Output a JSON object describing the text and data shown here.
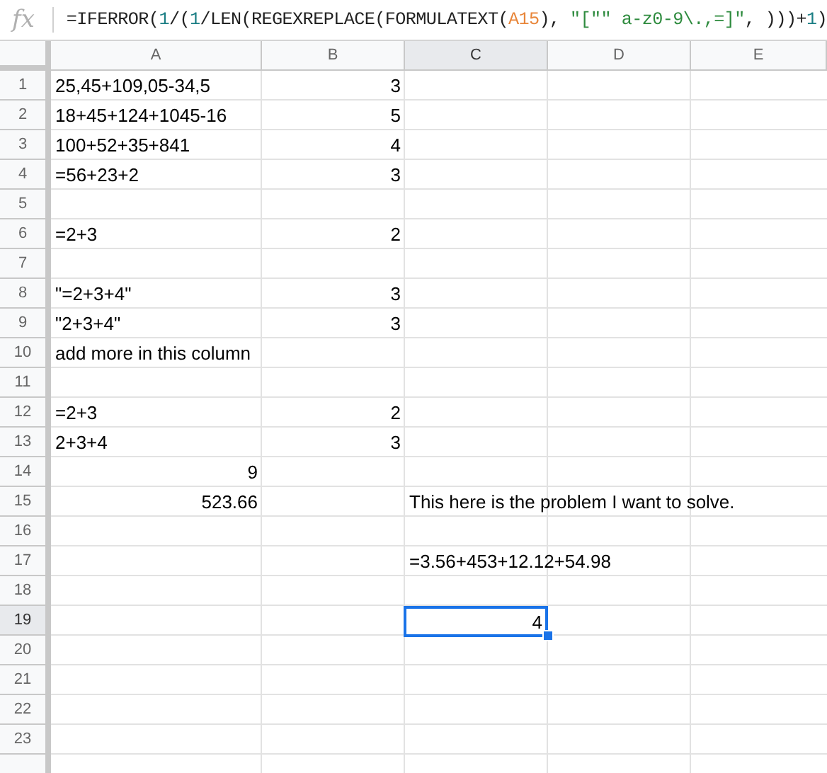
{
  "formula_bar": {
    "icon": "fx",
    "formula": [
      {
        "kind": "func",
        "text": "=IFERROR("
      },
      {
        "kind": "number",
        "text": "1"
      },
      {
        "kind": "func",
        "text": "/("
      },
      {
        "kind": "number",
        "text": "1"
      },
      {
        "kind": "func",
        "text": "/LEN(REGEXREPLACE(FORMULATEXT("
      },
      {
        "kind": "ref",
        "text": "A15"
      },
      {
        "kind": "func",
        "text": "), "
      },
      {
        "kind": "string",
        "text": "\"[\"\" a-z0-9\\.,=]\""
      },
      {
        "kind": "func",
        "text": ", )))+"
      },
      {
        "kind": "number",
        "text": "1"
      },
      {
        "kind": "func",
        "text": ")"
      }
    ]
  },
  "columns": [
    {
      "label": "A",
      "selected": false
    },
    {
      "label": "B",
      "selected": false
    },
    {
      "label": "C",
      "selected": true
    },
    {
      "label": "D",
      "selected": false
    },
    {
      "label": "E",
      "selected": false
    }
  ],
  "rows": [
    {
      "label": "1",
      "selected": false,
      "A": {
        "text": "25,45+109,05-34,5",
        "kind": "text",
        "selected": false
      },
      "B": {
        "text": "3",
        "kind": "number",
        "selected": false
      }
    },
    {
      "label": "2",
      "selected": false,
      "A": {
        "text": "18+45+124+1045-16",
        "kind": "text",
        "selected": false
      },
      "B": {
        "text": "5",
        "kind": "number",
        "selected": false
      }
    },
    {
      "label": "3",
      "selected": false,
      "A": {
        "text": "100+52+35+841",
        "kind": "text",
        "selected": false
      },
      "B": {
        "text": "4",
        "kind": "number",
        "selected": false
      }
    },
    {
      "label": "4",
      "selected": false,
      "A": {
        "text": "=56+23+2",
        "kind": "text",
        "selected": false
      },
      "B": {
        "text": "3",
        "kind": "number",
        "selected": false
      }
    },
    {
      "label": "5",
      "selected": false
    },
    {
      "label": "6",
      "selected": false,
      "A": {
        "text": "=2+3",
        "kind": "text",
        "selected": false
      },
      "B": {
        "text": "2",
        "kind": "number",
        "selected": false
      }
    },
    {
      "label": "7",
      "selected": false
    },
    {
      "label": "8",
      "selected": false,
      "A": {
        "text": "\"=2+3+4\"",
        "kind": "text",
        "selected": false
      },
      "B": {
        "text": "3",
        "kind": "number",
        "selected": false
      }
    },
    {
      "label": "9",
      "selected": false,
      "A": {
        "text": "\"2+3+4\"",
        "kind": "text",
        "selected": false
      },
      "B": {
        "text": "3",
        "kind": "number",
        "selected": false
      }
    },
    {
      "label": "10",
      "selected": false,
      "A": {
        "text": "add more in this column",
        "kind": "text",
        "selected": false
      }
    },
    {
      "label": "11",
      "selected": false
    },
    {
      "label": "12",
      "selected": false,
      "A": {
        "text": "=2+3",
        "kind": "text",
        "selected": false
      },
      "B": {
        "text": "2",
        "kind": "number",
        "selected": false
      }
    },
    {
      "label": "13",
      "selected": false,
      "A": {
        "text": "2+3+4",
        "kind": "text",
        "selected": false
      },
      "B": {
        "text": "3",
        "kind": "number",
        "selected": false
      }
    },
    {
      "label": "14",
      "selected": false,
      "A": {
        "text": "9",
        "kind": "number",
        "selected": false
      }
    },
    {
      "label": "15",
      "selected": false,
      "A": {
        "text": "523.66",
        "kind": "number",
        "selected": false
      },
      "C": {
        "text": "This here is the problem I want to solve.",
        "kind": "text",
        "selected": false
      }
    },
    {
      "label": "16",
      "selected": false
    },
    {
      "label": "17",
      "selected": false,
      "C": {
        "text": "=3.56+453+12.12+54.98",
        "kind": "text",
        "selected": false
      }
    },
    {
      "label": "18",
      "selected": false
    },
    {
      "label": "19",
      "selected": true,
      "C": {
        "text": "4",
        "kind": "number",
        "selected": true
      }
    },
    {
      "label": "20",
      "selected": false
    },
    {
      "label": "21",
      "selected": false
    },
    {
      "label": "22",
      "selected": false
    },
    {
      "label": "23",
      "selected": false
    }
  ]
}
